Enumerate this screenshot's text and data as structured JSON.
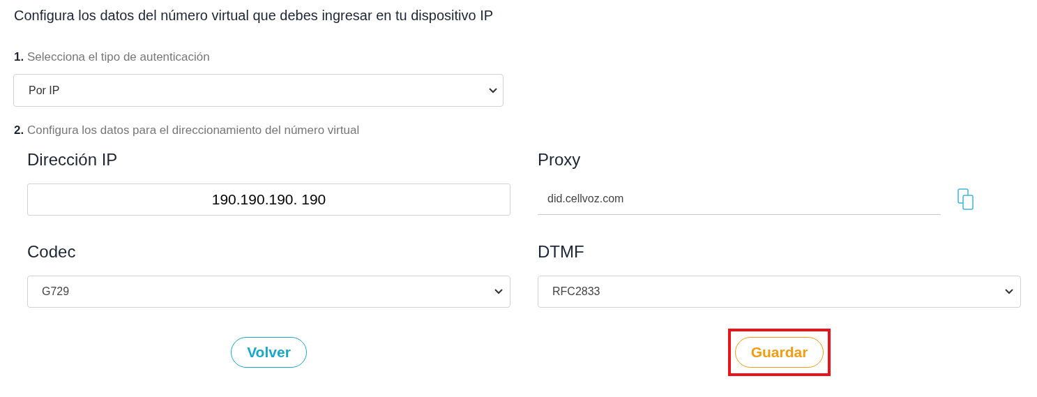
{
  "heading": "Configura los datos del número virtual que debes ingresar en tu dispositivo IP",
  "steps": [
    {
      "number": "1.",
      "text": "Selecciona el tipo de autenticación"
    },
    {
      "number": "2.",
      "text": "Configura los datos para el direccionamiento del número virtual"
    }
  ],
  "auth_select": {
    "value": "Por IP"
  },
  "fields": [
    {
      "kind": "boxed",
      "label": "Dirección IP",
      "value": "190.190.190. 190"
    },
    {
      "kind": "copy",
      "label": "Proxy",
      "value": "did.cellvoz.com"
    },
    {
      "kind": "select",
      "label": "Codec",
      "value": "G729"
    },
    {
      "kind": "select",
      "label": "DTMF",
      "value": "RFC2833"
    }
  ],
  "buttons": [
    {
      "label": "Volver",
      "kind": "secondary",
      "highlighted": false
    },
    {
      "label": "Guardar",
      "kind": "primary",
      "highlighted": true
    }
  ]
}
